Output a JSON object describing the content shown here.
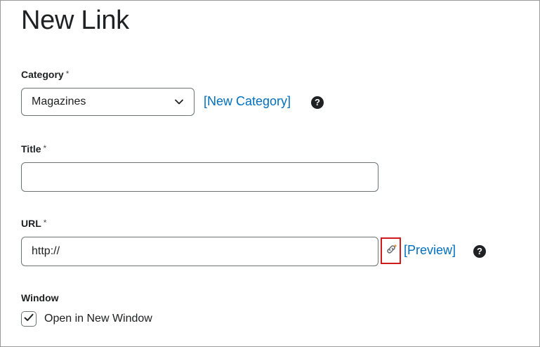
{
  "page": {
    "title": "New Link"
  },
  "category": {
    "label": "Category",
    "required_mark": "*",
    "selected": "Magazines",
    "new_category_link": "[New Category]"
  },
  "title_field": {
    "label": "Title",
    "required_mark": "*",
    "value": ""
  },
  "url_field": {
    "label": "URL",
    "required_mark": "*",
    "value": "http://",
    "preview_link": "[Preview]"
  },
  "window": {
    "label": "Window",
    "open_in_new_window_label": "Open in New Window",
    "open_in_new_window_checked": true
  },
  "icons": {
    "help": "help-icon",
    "chevron": "chevron-down-icon",
    "link_picker": "link-icon",
    "check": "checkmark-icon"
  },
  "colors": {
    "link": "#006fbf",
    "highlight_border": "#cf1b1b",
    "link_icon_accent": "#e6872c"
  }
}
